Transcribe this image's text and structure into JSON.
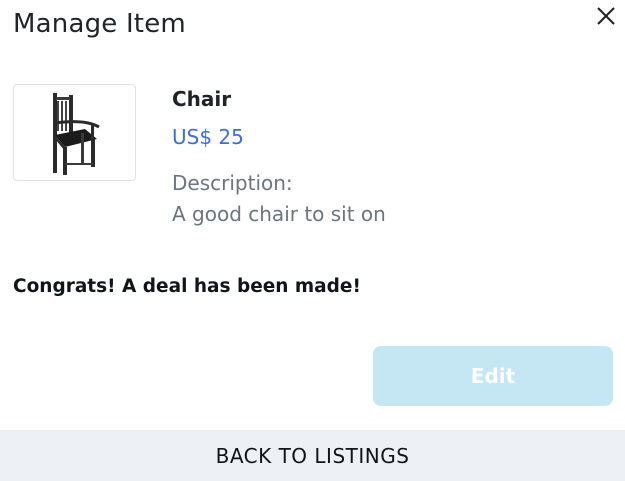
{
  "modal": {
    "title": "Manage Item"
  },
  "item": {
    "name": "Chair",
    "price": "US$ 25",
    "description_label": "Description:",
    "description": "A good chair to sit on",
    "image_icon": "chair-image"
  },
  "status": {
    "message": "Congrats! A deal has been made!"
  },
  "actions": {
    "edit_label": "Edit",
    "back_label": "BACK TO LISTINGS"
  },
  "colors": {
    "price": "#3b6fd6",
    "edit_button_disabled": "#c5e6f3",
    "back_bar": "#edf0f5",
    "muted_text": "#6c757d"
  }
}
